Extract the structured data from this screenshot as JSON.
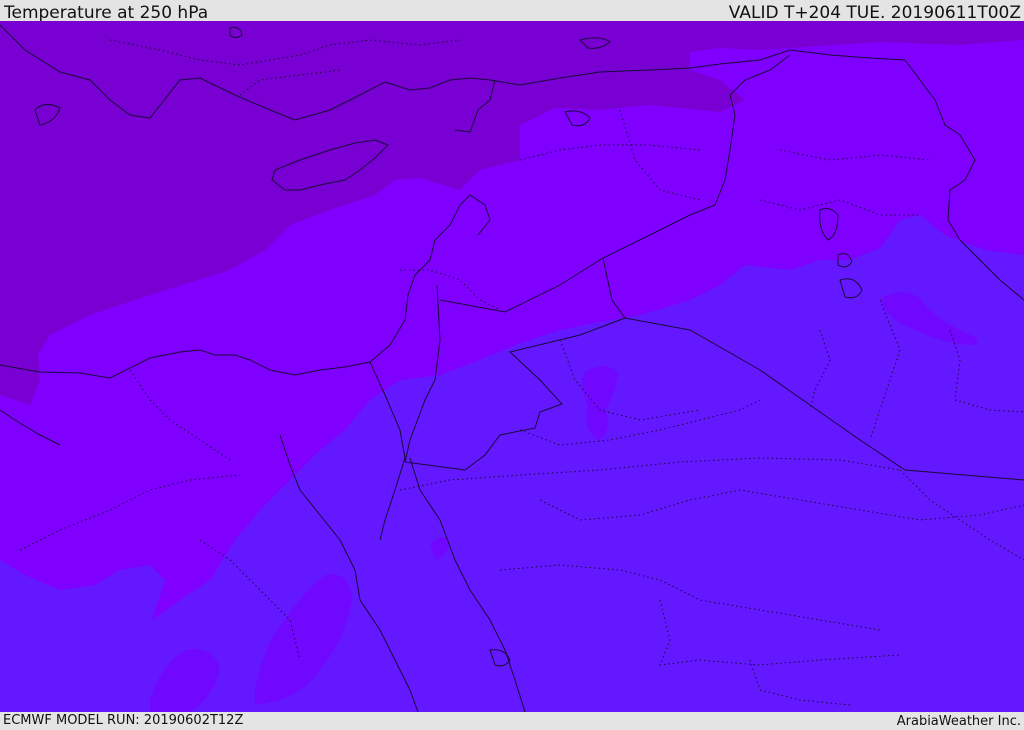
{
  "header": {
    "title": "Temperature at 250 hPa",
    "valid": "VALID T+204 TUE. 20190611T00Z"
  },
  "footer": {
    "model_run": "ECMWF MODEL RUN: 20190602T12Z",
    "credit": "ArabiaWeather Inc."
  },
  "map": {
    "field_colors": {
      "cold": "#7800d2",
      "mid": "#8000ff",
      "warm": "#6318ff",
      "warm_patch": "#7008ff"
    },
    "border_color": "#1a0a3a"
  }
}
